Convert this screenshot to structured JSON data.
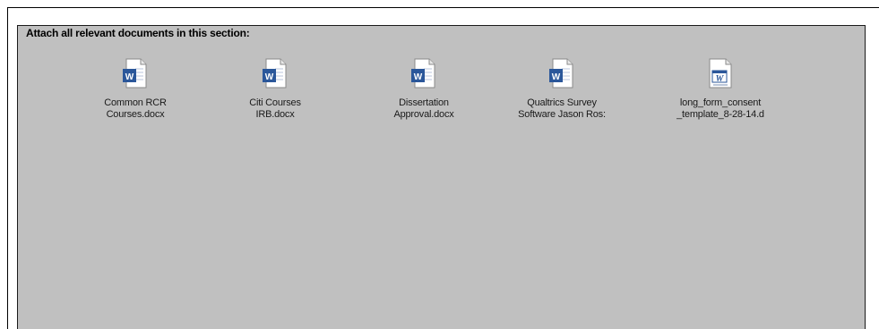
{
  "section": {
    "caption": "Attach all relevant documents in this section:"
  },
  "files": [
    {
      "name": "Common RCR\nCourses.docx",
      "icon": "word-document-icon"
    },
    {
      "name": "Citi Courses\nIRB.docx",
      "icon": "word-document-icon"
    },
    {
      "name": "Dissertation\nApproval.docx",
      "icon": "word-document-icon"
    },
    {
      "name": "Qualtrics Survey\nSoftware Jason Ros:",
      "icon": "word-document-icon"
    },
    {
      "name": "long_form_consent\n_template_8-28-14.d",
      "icon": "word-document-icon-legacy"
    }
  ]
}
